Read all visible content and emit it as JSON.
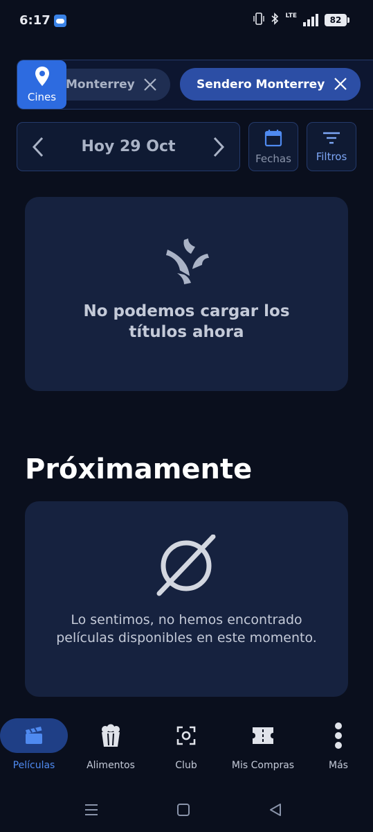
{
  "status_bar": {
    "time": "6:17",
    "network": "LTE",
    "battery": "82",
    "icons": [
      "weather-icon",
      "vibrate-icon",
      "bluetooth-icon",
      "signal-icon",
      "battery-icon"
    ]
  },
  "cinema_selector": {
    "button_label": "Cines",
    "button_icon": "location-pin-icon",
    "chips": [
      {
        "label": "Monterrey",
        "icon": "close-icon"
      },
      {
        "label": "Sendero Monterrey",
        "icon": "close-icon"
      }
    ]
  },
  "date_picker": {
    "label": "Hoy 29 Oct",
    "prev_icon": "chevron-left-icon",
    "next_icon": "chevron-right-icon"
  },
  "actions": {
    "dates_label": "Fechas",
    "filters_label": "Filtros"
  },
  "error_card": {
    "icon": "broken-connection-icon",
    "message": "No podemos cargar los títulos ahora"
  },
  "upcoming": {
    "title": "Próximamente",
    "icon": "empty-set-icon",
    "message": "Lo sentimos, no hemos encontrado películas disponibles en este momento."
  },
  "bottom_nav": {
    "items": [
      {
        "label": "Películas",
        "icon": "clapperboard-icon",
        "active": true
      },
      {
        "label": "Alimentos",
        "icon": "popcorn-icon",
        "active": false
      },
      {
        "label": "Club",
        "icon": "scan-icon",
        "active": false
      },
      {
        "label": "Mis Compras",
        "icon": "ticket-icon",
        "active": false
      },
      {
        "label": "Más",
        "icon": "more-vertical-icon",
        "active": false
      }
    ]
  },
  "colors": {
    "background": "#0a0f1d",
    "card": "#16223f",
    "accent": "#2d6be0",
    "chip_active": "#2c4ea5",
    "nav_active": "#4f8af0"
  }
}
